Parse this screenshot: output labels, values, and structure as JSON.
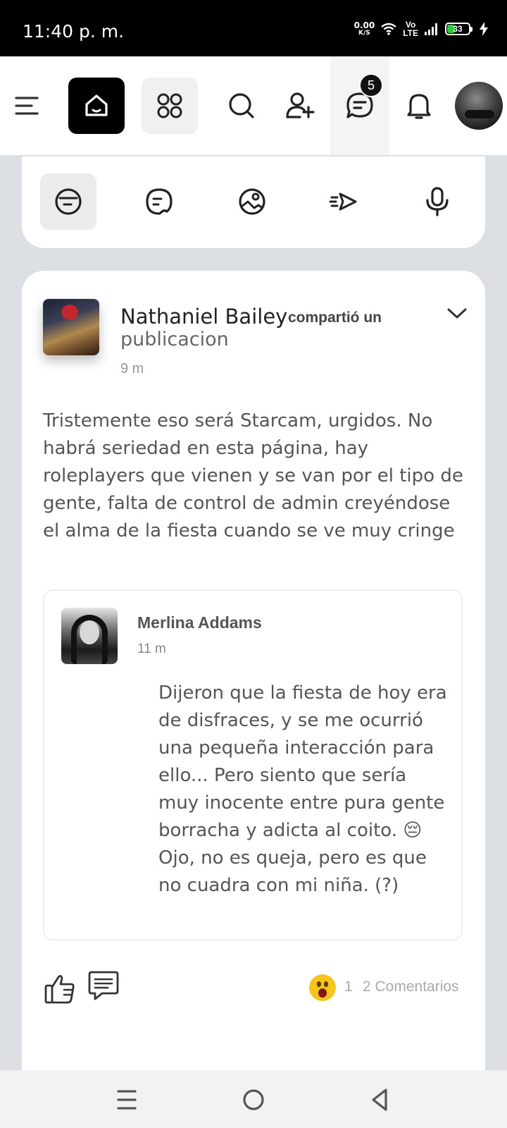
{
  "status_bar": {
    "time": "11:40 p. m.",
    "net_speed": "0.00",
    "net_unit": "K/S",
    "volte_top": "Vo",
    "volte_bottom": "LTE",
    "battery": "33",
    "battery_level": 0.33,
    "icons": [
      "wifi-icon",
      "signal-icon",
      "battery-icon",
      "charging-icon"
    ]
  },
  "top_nav": {
    "icons": [
      "menu-icon",
      "home-icon",
      "apps-icon",
      "search-icon",
      "add-friend-icon",
      "chat-icon",
      "bell-icon",
      "profile-avatar"
    ],
    "chat_badge": "5"
  },
  "composer": {
    "icons": [
      "status-icon",
      "message-icon",
      "photo-icon",
      "fast-post-icon",
      "mic-icon"
    ]
  },
  "post": {
    "author": "Nathaniel Bailey",
    "action_bold": "compartió un",
    "action_rest": "publicacion",
    "time": "9 m",
    "text": "Tristemente eso será Starcam, urgidos. No habrá seriedad en esta página, hay roleplayers que vienen y se van por el tipo de gente, falta de control de admin creyéndose el alma de la fiesta cuando se ve muy cringe",
    "shared": {
      "author": "Merlina Addams",
      "time": "11 m",
      "text": "Dijeron que la fiesta de hoy era de disfraces, y se me ocurrió una pequeña interacción para ello... Pero siento que sería muy inocente entre pura gente borracha y adicta al coito. 😔 Ojo, no es queja, pero es que no cuadra con mi niña. (?)"
    },
    "reaction_count": "1",
    "comments": "2 Comentarios"
  },
  "system_nav": {
    "icons": [
      "recents-icon",
      "home-circle-icon",
      "back-icon"
    ]
  }
}
